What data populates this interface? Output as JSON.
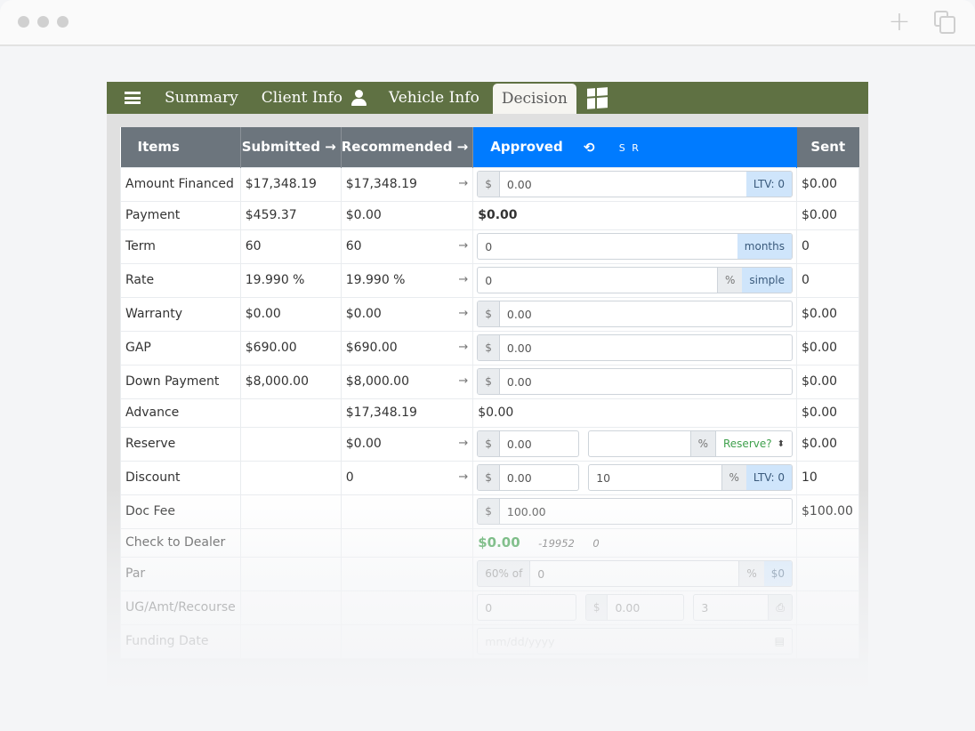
{
  "browser": {
    "new_tab_icon": "plus-icon",
    "windows_icon": "copy-windows-icon"
  },
  "nav": {
    "menu_icon": "hamburger-icon",
    "tabs": [
      {
        "label": "Summary",
        "active": false
      },
      {
        "label": "Client Info",
        "active": false,
        "icon": "user-icon"
      },
      {
        "label": "Vehicle Info",
        "active": false
      },
      {
        "label": "Decision",
        "active": true
      }
    ],
    "extra_icon": "windows-icon"
  },
  "table": {
    "headers": {
      "items": "Items",
      "submitted": "Submitted →",
      "recommended": "Recommended →",
      "approved": "Approved",
      "history_icon": "⟲",
      "sr": "S R",
      "sent": "Sent"
    },
    "accent_color": "#007bff",
    "header_color": "#6c757d",
    "nav_color": "#5f7143",
    "rows": {
      "amount_financed": {
        "label": "Amount Financed",
        "submitted": "$17,348.19",
        "recommended": "$17,348.19",
        "approved_prefix": "$",
        "approved_value": "0.00",
        "approved_suffix": "LTV: 0",
        "sent": "$0.00"
      },
      "payment": {
        "label": "Payment",
        "submitted": "$459.37",
        "recommended": "$0.00",
        "approved": "$0.00",
        "sent": "$0.00"
      },
      "term": {
        "label": "Term",
        "submitted": "60",
        "recommended": "60",
        "approved_value": "0",
        "approved_suffix": "months",
        "sent": "0"
      },
      "rate": {
        "label": "Rate",
        "submitted": "19.990 %",
        "recommended": "19.990 %",
        "approved_value": "0",
        "approved_unit": "%",
        "approved_suffix": "simple",
        "sent": "0"
      },
      "warranty": {
        "label": "Warranty",
        "submitted": "$0.00",
        "recommended": "$0.00",
        "approved_prefix": "$",
        "approved_value": "0.00",
        "sent": "$0.00"
      },
      "gap": {
        "label": "GAP",
        "submitted": "$690.00",
        "recommended": "$690.00",
        "approved_prefix": "$",
        "approved_value": "0.00",
        "sent": "$0.00"
      },
      "down_payment": {
        "label": "Down Payment",
        "submitted": "$8,000.00",
        "recommended": "$8,000.00",
        "approved_prefix": "$",
        "approved_value": "0.00",
        "sent": "$0.00"
      },
      "advance": {
        "label": "Advance",
        "submitted": "",
        "recommended": "$17,348.19",
        "approved": "$0.00",
        "sent": "$0.00"
      },
      "reserve": {
        "label": "Reserve",
        "submitted": "",
        "recommended": "$0.00",
        "approved_prefix": "$",
        "approved_value": "0.00",
        "pct_value": "",
        "pct_unit": "%",
        "select_label": "Reserve?",
        "sent": "$0.00"
      },
      "discount": {
        "label": "Discount",
        "submitted": "",
        "recommended": "0",
        "approved_prefix": "$",
        "approved_value": "0.00",
        "pct_value": "10",
        "pct_unit": "%",
        "pct_suffix": "LTV: 0",
        "sent": "10"
      },
      "doc_fee": {
        "label": "Doc Fee",
        "submitted": "",
        "recommended": "",
        "approved_prefix": "$",
        "approved_value": "100.00",
        "sent": "$100.00"
      },
      "check_to_dealer": {
        "label": "Check to Dealer",
        "approved": "$0.00",
        "note1": "-19952",
        "note2": "0",
        "sent": ""
      },
      "par": {
        "label": "Par",
        "approved_prefix": "60% of",
        "approved_value": "0",
        "approved_unit": "%",
        "approved_suffix": "$0",
        "sent": ""
      },
      "ug_amt_recourse": {
        "label": "UG/Amt/Recourse",
        "ug_value": "0",
        "amt_prefix": "$",
        "amt_value": "0.00",
        "recourse_value": "3",
        "print_icon": "print-icon",
        "sent": ""
      },
      "funding_date": {
        "label": "Funding Date",
        "placeholder": "mm/dd/yyyy",
        "calendar_icon": "calendar-icon",
        "sent": ""
      }
    },
    "row_arrow": "→"
  }
}
